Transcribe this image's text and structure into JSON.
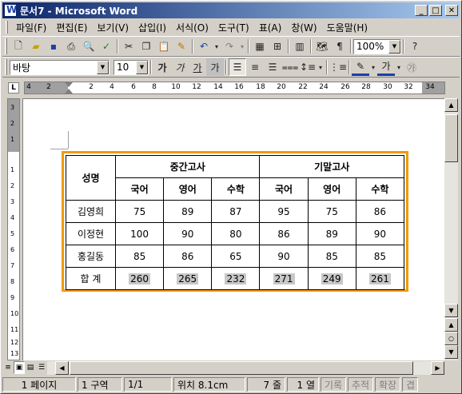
{
  "window": {
    "title": "문서7 - Microsoft Word"
  },
  "menu": [
    "파일(F)",
    "편집(E)",
    "보기(V)",
    "삽입(I)",
    "서식(O)",
    "도구(T)",
    "표(A)",
    "창(W)",
    "도움말(H)"
  ],
  "toolbar": {
    "zoom": "100%",
    "font": "바탕",
    "size": "10",
    "style_buttons": [
      "가",
      "가",
      "가",
      "가"
    ]
  },
  "ruler": {
    "ticks": [
      "4",
      "2",
      "2",
      "4",
      "6",
      "8",
      "10",
      "12",
      "14",
      "16",
      "18",
      "20",
      "22",
      "24",
      "26",
      "28",
      "30",
      "32",
      "34"
    ],
    "vticks": [
      "3",
      "2",
      "1",
      "1",
      "2",
      "3",
      "4",
      "5",
      "6",
      "7",
      "8",
      "9",
      "10",
      "11",
      "12",
      "13"
    ]
  },
  "table": {
    "name_header": "성명",
    "groups": [
      "중간고사",
      "기말고사"
    ],
    "subjects": [
      "국어",
      "영어",
      "수학",
      "국어",
      "영어",
      "수학"
    ],
    "rows": [
      {
        "name": "김영희",
        "values": [
          "75",
          "89",
          "87",
          "95",
          "75",
          "86"
        ]
      },
      {
        "name": "이정현",
        "values": [
          "100",
          "90",
          "80",
          "86",
          "89",
          "90"
        ]
      },
      {
        "name": "홍길동",
        "values": [
          "85",
          "86",
          "65",
          "90",
          "85",
          "85"
        ]
      }
    ],
    "total": {
      "name": "합 계",
      "values": [
        "260",
        "265",
        "232",
        "271",
        "249",
        "261"
      ]
    }
  },
  "status": {
    "page": "1 페이지",
    "section": "1 구역",
    "pages": "1/1",
    "position": "위치 8.1cm",
    "line": "7 줄",
    "column": "1 열",
    "rec": "기록",
    "trk": "추적",
    "ext": "확장",
    "ovr": "겹"
  }
}
